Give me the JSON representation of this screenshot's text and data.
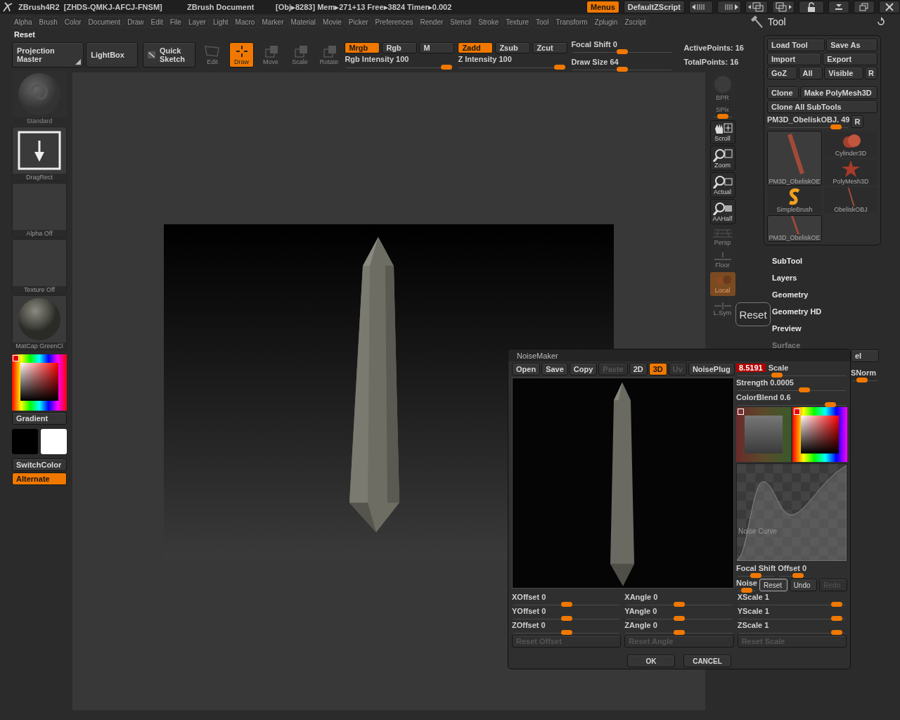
{
  "title_bar": {
    "app": "ZBrush4R2  [ZHDS-QMKJ-AFCJ-FNSM]",
    "document": "ZBrush Document",
    "stats": "[Obj▸8283] Mem▸271+13 Free▸3824 Timer▸0.002",
    "buttons": [
      {
        "label": "Menus",
        "selected": true
      },
      {
        "label": "DefaultZScript",
        "selected": false
      }
    ]
  },
  "menu_bar": [
    "Alpha",
    "Brush",
    "Color",
    "Document",
    "Draw",
    "Edit",
    "File",
    "Layer",
    "Light",
    "Macro",
    "Marker",
    "Material",
    "Movie",
    "Picker",
    "Preferences",
    "Render",
    "Stencil",
    "Stroke",
    "Texture",
    "Tool",
    "Transform",
    "Zplugin",
    "Zscript"
  ],
  "reset": "Reset",
  "top_shelf": {
    "buttons": [
      "Projection Master",
      "LightBox",
      "Quick Sketch"
    ],
    "tools": [
      {
        "label": "Edit",
        "kind": "edit",
        "selected": false,
        "disabled": true
      },
      {
        "label": "Draw",
        "kind": "draw",
        "selected": true,
        "disabled": false
      },
      {
        "label": "Move",
        "kind": "move",
        "selected": false,
        "disabled": true
      },
      {
        "label": "Scale",
        "kind": "scale",
        "selected": false,
        "disabled": true
      },
      {
        "label": "Rotate",
        "kind": "rotate",
        "selected": false,
        "disabled": true
      }
    ],
    "rgb_modes": [
      {
        "label": "Mrgb",
        "selected": true
      },
      {
        "label": "Rgb",
        "selected": false
      },
      {
        "label": "M",
        "selected": false
      }
    ],
    "rgb_intensity": {
      "label": "Rgb Intensity 100",
      "level": 1
    },
    "z_modes": [
      {
        "label": "Zadd",
        "selected": true
      },
      {
        "label": "Zsub",
        "selected": false
      },
      {
        "label": "Zcut",
        "selected": false
      }
    ],
    "z_intensity": {
      "label": "Z Intensity 100",
      "level": 1
    },
    "focal_shift": {
      "label": "Focal Shift 0",
      "level": 0.5
    },
    "draw_size": {
      "label": "Draw Size 64",
      "level": 0.5
    },
    "stats": [
      "ActivePoints: 16",
      "TotalPoints: 16"
    ]
  },
  "left_shelf": {
    "items": [
      {
        "label": "Standard",
        "kind": "brush",
        "disabled": true
      },
      {
        "label": "DragRect",
        "kind": "stroke",
        "disabled": false
      },
      {
        "label": "Alpha Off",
        "kind": "empty",
        "disabled": false
      },
      {
        "label": "Texture Off",
        "kind": "empty",
        "disabled": false
      },
      {
        "label": "MatCap GreenCl",
        "kind": "material",
        "disabled": false
      }
    ],
    "gradient": "Gradient",
    "switch_color": "SwitchColor",
    "alternate": {
      "label": "Alternate",
      "on": true
    }
  },
  "right_shelf": [
    {
      "label": "BPR",
      "kind": "bpr",
      "disabled": true
    },
    {
      "label": "SPix",
      "kind": "spix",
      "disabled": true,
      "level": 0.5
    },
    {
      "label": "Scroll",
      "kind": "scroll",
      "disabled": false
    },
    {
      "label": "Zoom",
      "kind": "zoom",
      "disabled": false
    },
    {
      "label": "Actual",
      "kind": "actual",
      "disabled": false
    },
    {
      "label": "AAHalf",
      "kind": "aahalf",
      "disabled": false
    },
    {
      "label": "Persp",
      "kind": "persp",
      "disabled": true
    },
    {
      "label": "Floor",
      "kind": "floor",
      "disabled": true
    },
    {
      "label": "Local",
      "kind": "local",
      "disabled": true
    },
    {
      "label": "L.Sym",
      "kind": "lsym",
      "disabled": true
    }
  ],
  "tool_panel": {
    "title": "Tool",
    "button_rows": [
      [
        "Load Tool",
        "Save As"
      ],
      [
        "Import",
        "Export"
      ],
      [
        "GoZ",
        "All",
        "Visible",
        "R"
      ]
    ],
    "clone_rows": [
      [
        "Clone",
        "Make PolyMesh3D"
      ],
      [
        "Clone All SubTools"
      ]
    ],
    "subtool_slider": {
      "label": "PM3D_ObeliskOBJ. 49",
      "level": 0.9
    },
    "slider_button": "R",
    "thumbnails": [
      {
        "label": "Cylinder3D",
        "kind": "cylinder",
        "selected": false
      },
      {
        "label": "PM3D_ObeliskOE",
        "kind": "stick",
        "selected": true
      },
      {
        "label": "PolyMesh3D",
        "kind": "star",
        "selected": false
      },
      {
        "label": "SimpleBrush",
        "kind": "swirl",
        "selected": false
      },
      {
        "label": "ObeliskOBJ",
        "kind": "thin",
        "selected": false
      },
      {
        "label": "PM3D_ObeliskOE",
        "kind": "stick",
        "selected": false
      }
    ],
    "subpalettes": [
      {
        "label": "SubTool",
        "disabled": false
      },
      {
        "label": "Layers",
        "disabled": false
      },
      {
        "label": "Geometry",
        "disabled": false
      },
      {
        "label": "Geometry HD",
        "disabled": false
      },
      {
        "label": "Preview",
        "disabled": false
      },
      {
        "label": "Surface",
        "disabled": true
      }
    ],
    "covered_button": "el",
    "covered_slider": {
      "label": "SNorm",
      "level": 0.3
    }
  },
  "tooltip": "Reset",
  "noise_maker": {
    "title": "NoiseMaker",
    "toolbar": [
      {
        "label": "Open",
        "selected": false,
        "disabled": false
      },
      {
        "label": "Save",
        "selected": false,
        "disabled": false
      },
      {
        "label": "Copy",
        "selected": false,
        "disabled": false
      },
      {
        "label": "Paste",
        "selected": false,
        "disabled": true
      },
      {
        "label": "2D",
        "selected": false,
        "disabled": false
      },
      {
        "label": "3D",
        "selected": true,
        "disabled": false
      },
      {
        "label": "Uv",
        "selected": false,
        "disabled": true
      },
      {
        "label": "NoisePlug",
        "selected": false,
        "disabled": false
      }
    ],
    "scale": {
      "value": "8.5191",
      "label": "Scale",
      "level": 0.35
    },
    "sliders": [
      {
        "label": "Strength 0.0005",
        "level": 0.63
      },
      {
        "label": "ColorBlend 0.6",
        "level": 0.9
      }
    ],
    "curve_label": "Noise Curve",
    "focal_shift": {
      "label": "Focal Shift",
      "level": 0.5
    },
    "offset": {
      "label": "Offset 0",
      "level": 0.9
    },
    "noise": {
      "label": "Noise",
      "level": 0.5
    },
    "noise_buttons": [
      {
        "label": "Reset",
        "highlighted": true,
        "disabled": false
      },
      {
        "label": "Undo",
        "highlighted": false,
        "disabled": false
      },
      {
        "label": "Redo",
        "highlighted": false,
        "disabled": true
      }
    ],
    "columns": [
      {
        "sliders": [
          {
            "label": "XOffset 0",
            "level": 0.5
          },
          {
            "label": "YOffset 0",
            "level": 0.5
          },
          {
            "label": "ZOffset 0",
            "level": 0.5
          }
        ],
        "reset": {
          "label": "Reset Offset",
          "disabled": true
        }
      },
      {
        "sliders": [
          {
            "label": "XAngle 0",
            "level": 0.5
          },
          {
            "label": "YAngle 0",
            "level": 0.5
          },
          {
            "label": "ZAngle 0",
            "level": 0.5
          }
        ],
        "reset": {
          "label": "Reset Angle",
          "disabled": true
        }
      },
      {
        "sliders": [
          {
            "label": "XScale 1",
            "level": 0.97
          },
          {
            "label": "YScale 1",
            "level": 0.97
          },
          {
            "label": "ZScale 1",
            "level": 0.97
          }
        ],
        "reset": {
          "label": "Reset Scale",
          "disabled": true
        }
      }
    ],
    "buttons": [
      "OK",
      "CANCEL"
    ]
  }
}
